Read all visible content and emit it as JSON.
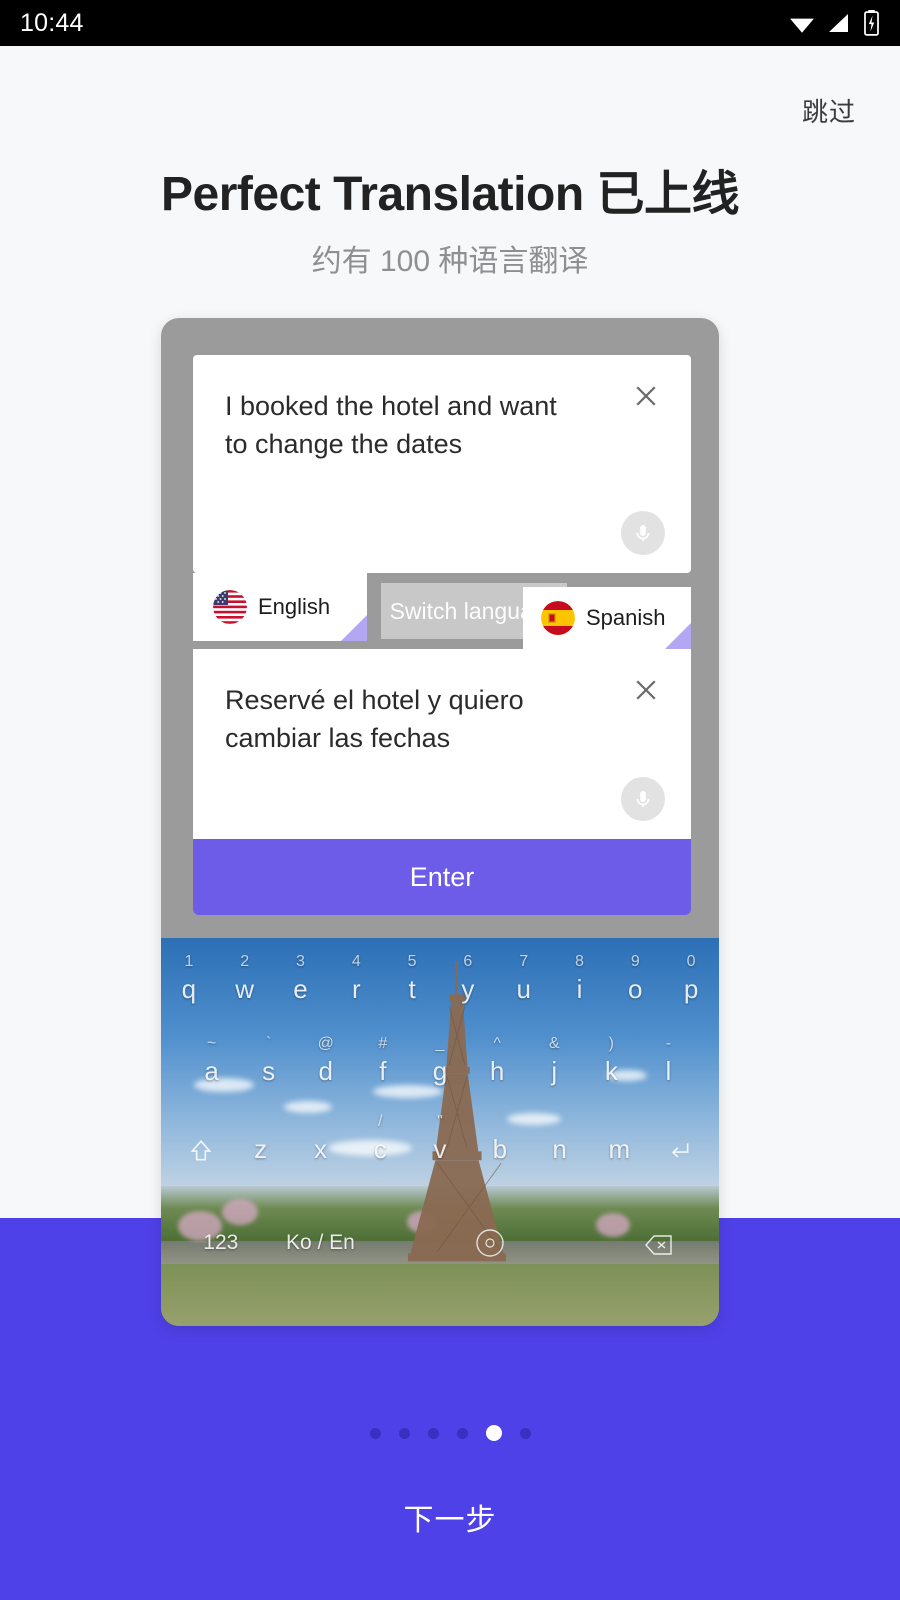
{
  "status_bar": {
    "time": "10:44",
    "icons": [
      "wifi-icon",
      "signal-icon",
      "battery-charging-icon"
    ]
  },
  "header": {
    "skip_label": "跳过",
    "title": "Perfect Translation 已上线",
    "subtitle": "约有 100 种语言翻译"
  },
  "translator": {
    "source": {
      "text": "I booked the hotel and want to change the dates",
      "clear_icon": "close-icon",
      "mic_icon": "microphone-icon"
    },
    "target": {
      "text": "Reservé el hotel y quiero cambiar las fechas",
      "clear_icon": "close-icon",
      "mic_icon": "microphone-icon"
    },
    "language_left": "English",
    "language_left_flag": "flag-usa",
    "language_right": "Spanish",
    "language_right_flag": "flag-spain",
    "switch_label": "Switch language",
    "enter_label": "Enter",
    "accent_color": "#6c5ce7",
    "corner_marker_color": "#b3a7f3",
    "switch_button_color": "#c8c8c8"
  },
  "keyboard": {
    "row1": [
      {
        "key": "q",
        "alt": "1"
      },
      {
        "key": "w",
        "alt": "2"
      },
      {
        "key": "e",
        "alt": "3"
      },
      {
        "key": "r",
        "alt": "4"
      },
      {
        "key": "t",
        "alt": "5"
      },
      {
        "key": "y",
        "alt": "6"
      },
      {
        "key": "u",
        "alt": "7"
      },
      {
        "key": "i",
        "alt": "8"
      },
      {
        "key": "o",
        "alt": "9"
      },
      {
        "key": "p",
        "alt": "0"
      }
    ],
    "row2": [
      {
        "key": "a",
        "alt": "~"
      },
      {
        "key": "s",
        "alt": "`"
      },
      {
        "key": "d",
        "alt": "@"
      },
      {
        "key": "f",
        "alt": "#"
      },
      {
        "key": "g",
        "alt": "_"
      },
      {
        "key": "h",
        "alt": "^"
      },
      {
        "key": "j",
        "alt": "&"
      },
      {
        "key": "k",
        "alt": ")"
      },
      {
        "key": "l",
        "alt": "-"
      }
    ],
    "row3": [
      {
        "key": "z",
        "alt": ""
      },
      {
        "key": "x",
        "alt": ""
      },
      {
        "key": "c",
        "alt": "/"
      },
      {
        "key": "v",
        "alt": "\""
      },
      {
        "key": "b",
        "alt": ""
      },
      {
        "key": "n",
        "alt": ""
      },
      {
        "key": "m",
        "alt": ""
      }
    ],
    "shift_icon": "shift-icon",
    "return_icon": "return-icon",
    "num_key": "123",
    "lang_key": "Ko / En",
    "space_icon": "space-circle-icon",
    "backspace_icon": "backspace-icon"
  },
  "footer": {
    "dots_total": 6,
    "dot_active_index": 4,
    "next_label": "下一步",
    "background_color": "#4f41e8"
  }
}
